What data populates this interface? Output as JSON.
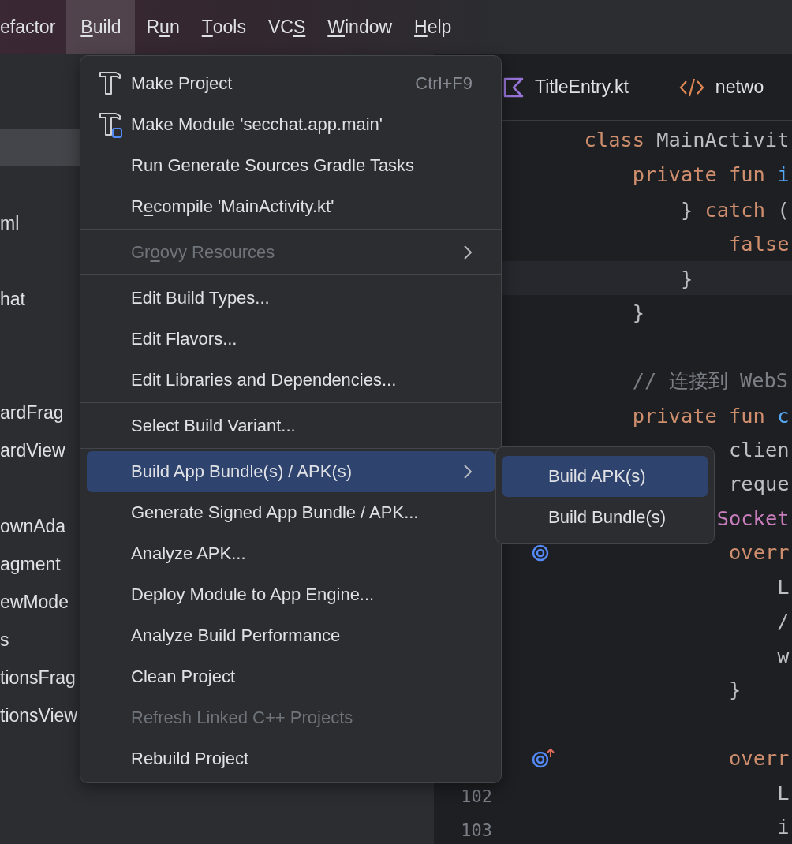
{
  "menu_bar": {
    "items": [
      {
        "label": [
          {
            "text": "efactor",
            "underlined": false
          }
        ],
        "selected": false
      },
      {
        "label": [
          {
            "text": "B",
            "underlined": true
          },
          {
            "text": "uild",
            "underlined": false
          }
        ],
        "selected": true
      },
      {
        "label": [
          {
            "text": "R",
            "underlined": false
          },
          {
            "text": "u",
            "underlined": true
          },
          {
            "text": "n",
            "underlined": false
          }
        ],
        "selected": false
      },
      {
        "label": [
          {
            "text": "T",
            "underlined": true
          },
          {
            "text": "ools",
            "underlined": false
          }
        ],
        "selected": false
      },
      {
        "label": [
          {
            "text": "VC",
            "underlined": false
          },
          {
            "text": "S",
            "underlined": true
          }
        ],
        "selected": false
      },
      {
        "label": [
          {
            "text": "W",
            "underlined": true
          },
          {
            "text": "indow",
            "underlined": false
          }
        ],
        "selected": false
      },
      {
        "label": [
          {
            "text": "H",
            "underlined": true
          },
          {
            "text": "elp",
            "underlined": false
          }
        ],
        "selected": false
      }
    ]
  },
  "project_tree": {
    "rows": [
      {
        "selected": true
      },
      {
        "selected": false
      },
      {
        "label": "ml",
        "selected": false
      },
      {
        "selected": false
      },
      {
        "label": "hat",
        "selected": false
      },
      {
        "selected": false
      },
      {
        "selected": false
      },
      {
        "label": "ardFrag",
        "selected": false
      },
      {
        "label": "ardView",
        "selected": false
      },
      {
        "selected": false
      },
      {
        "label": "ownAda",
        "selected": false
      },
      {
        "label": "agment",
        "selected": false
      },
      {
        "label": "ewMode",
        "selected": false
      },
      {
        "label": "s",
        "selected": false
      },
      {
        "label": "tionsFrag",
        "selected": false
      },
      {
        "label": "tionsView",
        "selected": false
      }
    ]
  },
  "editor": {
    "tabs": [
      {
        "label": "TitleEntry.kt",
        "kind": "kotlin"
      },
      {
        "label": "netwo",
        "kind": "xml"
      }
    ],
    "sticky_lines": [
      {
        "kind": "code",
        "tokens": [
          {
            "text": "  class ",
            "kind": "keyword"
          },
          {
            "text": "MainActivit",
            "kind": "plain"
          }
        ]
      },
      {
        "kind": "code",
        "tokens": [
          {
            "text": "      private fun ",
            "kind": "keyword"
          },
          {
            "text": "i",
            "kind": "function"
          }
        ]
      }
    ],
    "lines": [
      {
        "kind": "code",
        "current": false,
        "tokens": [
          {
            "text": "          } ",
            "kind": "plain"
          },
          {
            "text": "catch ",
            "kind": "keyword"
          },
          {
            "text": "(",
            "kind": "plain"
          }
        ]
      },
      {
        "kind": "code",
        "current": false,
        "tokens": [
          {
            "text": "              false",
            "kind": "keyword"
          }
        ]
      },
      {
        "kind": "code",
        "current": true,
        "tokens": [
          {
            "text": "          }",
            "kind": "plain"
          }
        ]
      },
      {
        "kind": "code",
        "current": false,
        "tokens": [
          {
            "text": "      }",
            "kind": "plain"
          }
        ]
      },
      {
        "kind": "blank",
        "current": false
      },
      {
        "kind": "code",
        "current": false,
        "tokens": [
          {
            "text": "      // 连接到 WebS",
            "kind": "comment"
          }
        ]
      },
      {
        "kind": "code",
        "current": false,
        "tokens": [
          {
            "text": "      private fun ",
            "kind": "keyword"
          },
          {
            "text": "c",
            "kind": "function"
          }
        ]
      },
      {
        "kind": "code",
        "current": false,
        "tokens": [
          {
            "text": "              clien",
            "kind": "plain"
          }
        ]
      },
      {
        "kind": "code",
        "current": false,
        "tokens": [
          {
            "text": "              reque",
            "kind": "plain"
          }
        ]
      },
      {
        "kind": "code",
        "current": false,
        "tokens": [
          {
            "text": "             Socket",
            "kind": "type"
          }
        ]
      },
      {
        "kind": "code",
        "current": false,
        "gutter_icon": {
          "kind": "override"
        },
        "tokens": [
          {
            "text": "              overr",
            "kind": "keyword"
          }
        ]
      },
      {
        "kind": "code",
        "current": false,
        "tokens": [
          {
            "text": "                  L",
            "kind": "plain"
          }
        ]
      },
      {
        "kind": "code",
        "current": false,
        "tokens": [
          {
            "text": "                  /",
            "kind": "plain"
          }
        ]
      },
      {
        "kind": "code",
        "current": false,
        "tokens": [
          {
            "text": "                  w",
            "kind": "plain"
          }
        ]
      },
      {
        "kind": "code",
        "current": false,
        "tokens": [
          {
            "text": "              }",
            "kind": "plain"
          }
        ]
      },
      {
        "kind": "blank",
        "current": false
      },
      {
        "kind": "code",
        "current": false,
        "gutter_icon": {
          "kind": "overrideup"
        },
        "tokens": [
          {
            "text": "              overr",
            "kind": "keyword"
          }
        ]
      },
      {
        "kind": "code",
        "current": false,
        "number": "102",
        "tokens": [
          {
            "text": "                  L",
            "kind": "plain"
          }
        ]
      },
      {
        "kind": "code",
        "current": false,
        "number": "103",
        "tokens": [
          {
            "text": "                  i",
            "kind": "plain"
          }
        ]
      }
    ]
  },
  "build_menu": {
    "items": [
      {
        "kind": "item",
        "label": "Make Project",
        "shortcut": "Ctrl+F9",
        "disabled": false,
        "selected": false
      },
      {
        "kind": "item",
        "label": "Make Module 'secchat.app.main'",
        "disabled": false,
        "selected": false
      },
      {
        "kind": "item",
        "label": "Run Generate Sources Gradle Tasks",
        "disabled": false,
        "selected": false
      },
      {
        "kind": "item",
        "label": [
          {
            "text": "R",
            "underlined": false
          },
          {
            "text": "e",
            "underlined": true
          },
          {
            "text": "compile 'MainActivity.kt'",
            "underlined": false
          }
        ],
        "disabled": false,
        "selected": false
      },
      {
        "kind": "separator"
      },
      {
        "kind": "submenu",
        "label": [
          {
            "text": "Gr",
            "underlined": false
          },
          {
            "text": "o",
            "underlined": true
          },
          {
            "text": "ovy Resources",
            "underlined": false
          }
        ],
        "disabled": true,
        "selected": false
      },
      {
        "kind": "separator"
      },
      {
        "kind": "item",
        "label": "Edit Build Types...",
        "disabled": false,
        "selected": false
      },
      {
        "kind": "item",
        "label": "Edit Flavors...",
        "disabled": false,
        "selected": false
      },
      {
        "kind": "item",
        "label": "Edit Libraries and Dependencies...",
        "disabled": false,
        "selected": false
      },
      {
        "kind": "separator"
      },
      {
        "kind": "item",
        "label": "Select Build Variant...",
        "disabled": false,
        "selected": false
      },
      {
        "kind": "separator"
      },
      {
        "kind": "submenu",
        "label": "Build App Bundle(s) / APK(s)",
        "disabled": false,
        "selected": true
      },
      {
        "kind": "item",
        "label": "Generate Signed App Bundle / APK...",
        "disabled": false,
        "selected": false
      },
      {
        "kind": "item",
        "label": "Analyze APK...",
        "disabled": false,
        "selected": false
      },
      {
        "kind": "item",
        "label": "Deploy Module to App Engine...",
        "disabled": false,
        "selected": false
      },
      {
        "kind": "item",
        "label": "Analyze Build Performance",
        "disabled": false,
        "selected": false
      },
      {
        "kind": "item",
        "label": "Clean Project",
        "disabled": false,
        "selected": false
      },
      {
        "kind": "item",
        "label": "Refresh Linked C++ Projects",
        "disabled": true,
        "selected": false
      },
      {
        "kind": "item",
        "label": "Rebuild Project",
        "disabled": false,
        "selected": false
      }
    ]
  },
  "submenu": {
    "items": [
      {
        "label": "Build APK(s)",
        "selected": true
      },
      {
        "label": "Build Bundle(s)",
        "selected": false
      }
    ]
  }
}
